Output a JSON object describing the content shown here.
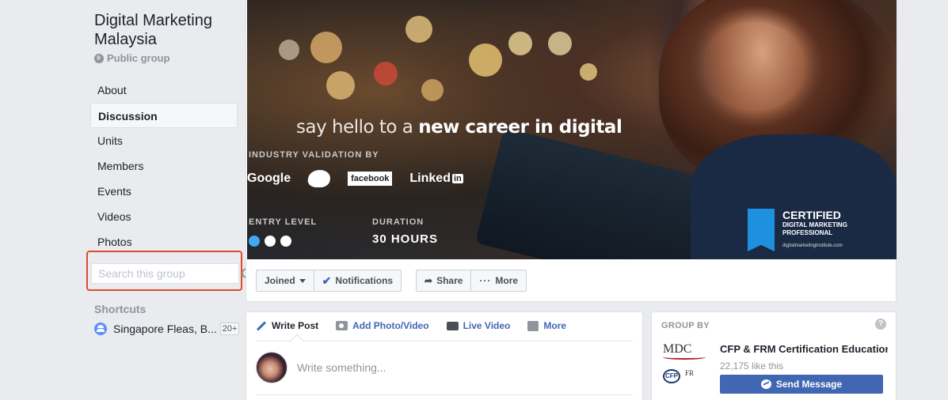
{
  "group": {
    "name": "Digital Marketing Malaysia",
    "privacy": "Public group"
  },
  "nav": [
    {
      "label": "About",
      "active": false
    },
    {
      "label": "Discussion",
      "active": true
    },
    {
      "label": "Units",
      "active": false
    },
    {
      "label": "Members",
      "active": false
    },
    {
      "label": "Events",
      "active": false
    },
    {
      "label": "Videos",
      "active": false
    },
    {
      "label": "Photos",
      "active": false
    }
  ],
  "search": {
    "placeholder": "Search this group"
  },
  "shortcuts": {
    "title": "Shortcuts",
    "items": [
      {
        "label": "Singapore Fleas, B...",
        "badge": "20+"
      }
    ]
  },
  "cover": {
    "headline_pre": "say hello to a ",
    "headline_bold": "new career in digital",
    "validation_label": "INDUSTRY VALIDATION BY",
    "logos": {
      "google": "Google",
      "facebook": "facebook",
      "linkedin": "Linked",
      "linkedin_box": "in"
    },
    "entry_label": "ENTRY LEVEL",
    "duration_label": "DURATION",
    "duration_value": "30 HOURS",
    "certified_title": "CERTIFIED",
    "certified_sub1": "DIGITAL MARKETING",
    "certified_sub2": "PROFESSIONAL",
    "certified_url": "digitalmarketinginstitute.com"
  },
  "actions": {
    "joined": "Joined",
    "notifications": "Notifications",
    "share": "Share",
    "more": "More"
  },
  "composer": {
    "tabs": {
      "write_post": "Write Post",
      "add_photo": "Add Photo/Video",
      "live_video": "Live Video",
      "more": "More"
    },
    "placeholder": "Write something..."
  },
  "group_by": {
    "title": "GROUP BY",
    "logo_text": "MDC",
    "logo_cfp": "CFP",
    "logo_frm": "FR",
    "name": "CFP & FRM Certification Education",
    "likes": "22,175 like this",
    "send_message": "Send Message"
  },
  "colors": {
    "accent": "#4267b2",
    "highlight": "#e2492c",
    "background": "#e9ebee"
  }
}
